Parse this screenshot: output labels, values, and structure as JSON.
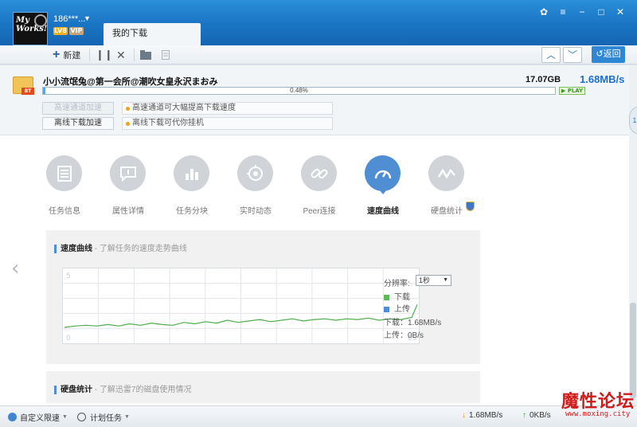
{
  "user": {
    "name": "186***...",
    "level": "LV8",
    "vip": "VIP"
  },
  "tab": {
    "label": "我的下载"
  },
  "toolbar": {
    "new_label": "新建",
    "back_label": "返回"
  },
  "task": {
    "name": "小小流氓兔@第一会所@潮吹女皇永沢まおみ",
    "size": "17.07GB",
    "speed": "1.68MB/s",
    "progress_text": "0.48%",
    "progress": 0.48,
    "play_label": "PLAY",
    "bt_badge": "BT"
  },
  "accel": {
    "highspeed_button": "高速通道加速",
    "highspeed_tip": "高速通道可大幅提高下载速度",
    "offline_button": "离线下载加速",
    "offline_tip": "离线下载可代你挂机"
  },
  "detail_tabs": [
    {
      "label": "任务信息",
      "icon": "info-list-icon"
    },
    {
      "label": "属性详情",
      "icon": "chat-detail-icon"
    },
    {
      "label": "任务分块",
      "icon": "bar-blocks-icon"
    },
    {
      "label": "实时动态",
      "icon": "target-icon"
    },
    {
      "label": "Peer连接",
      "icon": "link-icon"
    },
    {
      "label": "速度曲线",
      "icon": "speedometer-icon"
    },
    {
      "label": "硬盘统计",
      "icon": "wave-icon"
    }
  ],
  "speed_panel": {
    "title": "速度曲线",
    "subtitle": " - 了解任务的速度走势曲线",
    "resolution_label": "分辨率:",
    "resolution_value": "1秒",
    "legend_download": "下载",
    "legend_upload": "上传",
    "download_speed": "下载：1.68MB/s",
    "upload_speed": "上传：0B/s",
    "axis_top": "5",
    "axis_zero": "0",
    "axis_right": "65"
  },
  "disk_panel": {
    "title": "硬盘统计",
    "subtitle": " - 了解迅雷7的磁盘使用情况"
  },
  "statusbar": {
    "speed_limit": "自定义限速",
    "schedule": "计划任务",
    "down_speed": "1.68MB/s",
    "up_speed": "0KB/s"
  },
  "watermark": {
    "text": "魔性论坛",
    "url": "www.moxing.city"
  },
  "colors": {
    "accent": "#1a6fd1",
    "download_line": "#4cae4c",
    "upload": "#4f8ed3"
  },
  "chart_data": {
    "type": "line",
    "title": "",
    "xlabel": "",
    "ylabel": "",
    "x": [
      0,
      2,
      4,
      6,
      8,
      10,
      12,
      14,
      16,
      18,
      20,
      22,
      24,
      26,
      28,
      30,
      32,
      34,
      36,
      38,
      40,
      42,
      44,
      46,
      48,
      50,
      52,
      54,
      56,
      58,
      60,
      62,
      64,
      65
    ],
    "series": [
      {
        "name": "下载",
        "values": [
          1.0,
          1.1,
          1.15,
          1.1,
          1.2,
          1.1,
          1.25,
          1.15,
          1.3,
          1.2,
          1.15,
          1.35,
          1.25,
          1.4,
          1.3,
          1.5,
          1.35,
          1.45,
          1.55,
          1.4,
          1.5,
          1.6,
          1.45,
          1.55,
          1.6,
          1.5,
          1.6,
          1.55,
          1.65,
          1.5,
          1.6,
          1.55,
          1.7,
          2.6
        ]
      },
      {
        "name": "上传",
        "values": [
          0,
          0,
          0,
          0,
          0,
          0,
          0,
          0,
          0,
          0,
          0,
          0,
          0,
          0,
          0,
          0,
          0,
          0,
          0,
          0,
          0,
          0,
          0,
          0,
          0,
          0,
          0,
          0,
          0,
          0,
          0,
          0,
          0,
          0
        ]
      }
    ],
    "ylim": [
      0,
      5
    ],
    "xlim": [
      0,
      65
    ],
    "grid": true
  }
}
